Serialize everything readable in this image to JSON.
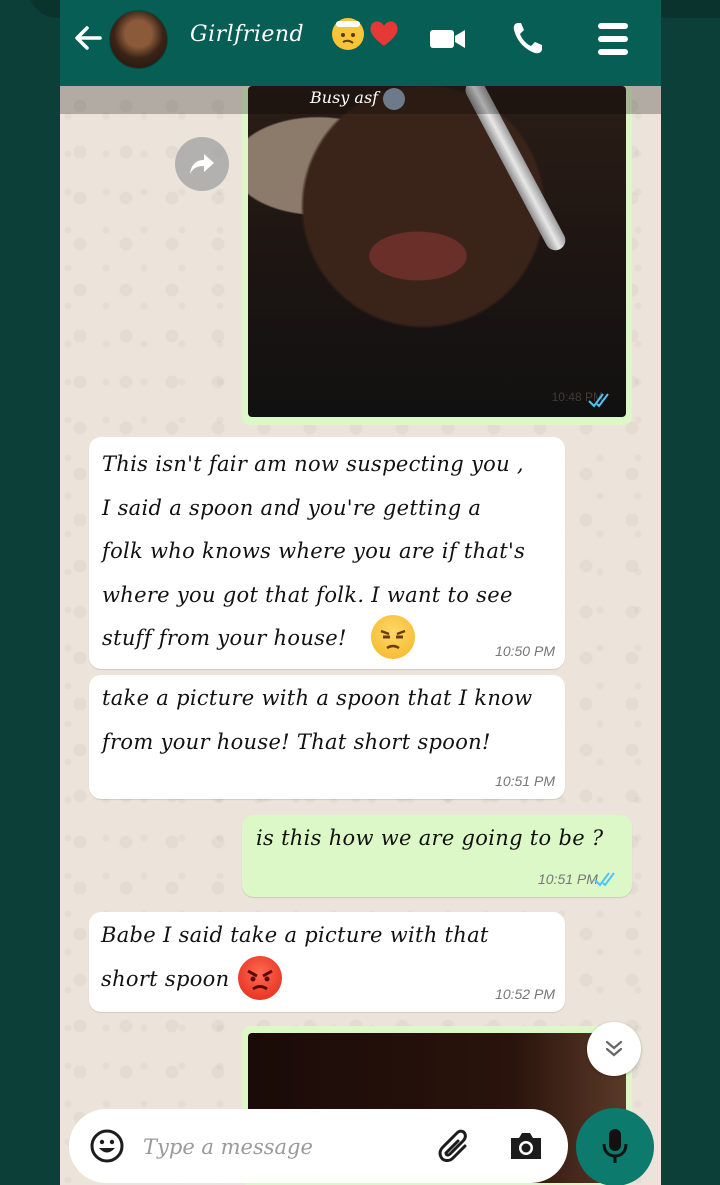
{
  "header": {
    "contact_name": "Girlfriend",
    "status_emojis": [
      "confused-face",
      "red-heart"
    ],
    "icons": [
      "back-arrow-icon",
      "video-call-icon",
      "phone-icon",
      "menu-icon"
    ]
  },
  "messages": [
    {
      "type": "image",
      "direction": "outgoing",
      "caption": "Busy asf",
      "time": "10:48 PM",
      "ticks": "read"
    },
    {
      "type": "text",
      "direction": "incoming",
      "text": "This isn't fair am now suspecting you ,\nI said a spoon and you're getting a\nfolk who knows where you are if that's\nwhere you got that folk. I want to see\nstuff from your house!",
      "emoji": "unamused-face",
      "time": "10:50 PM"
    },
    {
      "type": "text",
      "direction": "incoming",
      "text": "take a picture with a spoon that I know\nfrom your house! That short spoon!",
      "time": "10:51 PM"
    },
    {
      "type": "text",
      "direction": "outgoing",
      "text": "is this how we are going to be ?",
      "time": "10:51 PM",
      "ticks": "read"
    },
    {
      "type": "text",
      "direction": "incoming",
      "text": "Babe I said take a picture with that\nshort spoon",
      "emoji": "angry-face",
      "time": "10:52 PM"
    },
    {
      "type": "image",
      "direction": "outgoing",
      "caption": "",
      "time": "",
      "ticks": ""
    }
  ],
  "composer": {
    "placeholder": "Type a message"
  },
  "colors": {
    "header": "#075e54",
    "outgoing_bubble": "#dcf8c6",
    "incoming_bubble": "#ffffff",
    "read_ticks": "#4fc3f7",
    "mic_button": "#0c7a6c",
    "chat_background": "#ece4da"
  }
}
